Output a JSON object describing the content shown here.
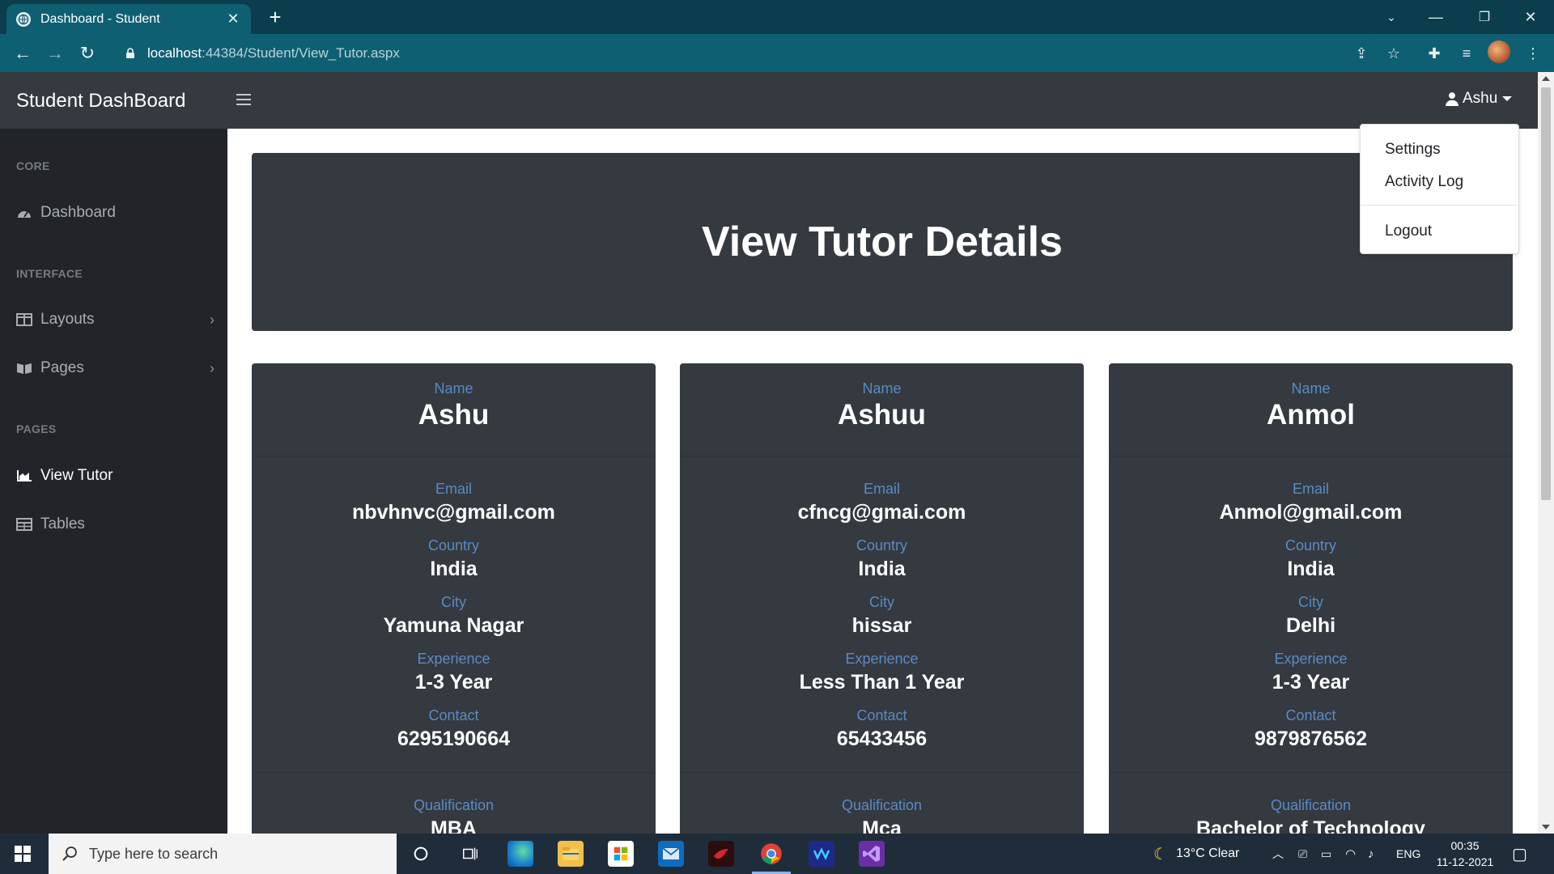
{
  "browser": {
    "tab_title": "Dashboard - Student",
    "tab_close": "✕",
    "new_tab": "+",
    "url_host": "localhost",
    "url_path": ":44384/Student/View_Tutor.aspx"
  },
  "topnav": {
    "brand": "Student DashBoard",
    "user_name": "Ashu"
  },
  "user_dropdown": {
    "items": [
      "Settings",
      "Activity Log",
      "Logout"
    ]
  },
  "sidebar": {
    "sections": [
      {
        "heading": "CORE"
      },
      {
        "heading": "INTERFACE"
      },
      {
        "heading": "PAGES"
      }
    ],
    "items": [
      {
        "label": "Dashboard",
        "icon": "tachometer-icon"
      },
      {
        "label": "Layouts",
        "icon": "columns-icon"
      },
      {
        "label": "Pages",
        "icon": "book-open-icon"
      },
      {
        "label": "View Tutor",
        "icon": "area-chart-icon"
      },
      {
        "label": "Tables",
        "icon": "table-icon"
      }
    ]
  },
  "main": {
    "hero_title": "View Tutor Details",
    "labels": {
      "name": "Name",
      "email": "Email",
      "country": "Country",
      "city": "City",
      "experience": "Experience",
      "contact": "Contact",
      "qualification": "Qualification"
    },
    "tutors": [
      {
        "name": "Ashu",
        "email": "nbvhnvc@gmail.com",
        "country": "India",
        "city": "Yamuna Nagar",
        "experience": "1-3 Year",
        "contact": "6295190664",
        "qualification": "MBA"
      },
      {
        "name": "Ashuu",
        "email": "cfncg@gmai.com",
        "country": "India",
        "city": "hissar",
        "experience": "Less Than 1 Year",
        "contact": "65433456",
        "qualification": "Mca"
      },
      {
        "name": "Anmol",
        "email": "Anmol@gmail.com",
        "country": "India",
        "city": "Delhi",
        "experience": "1-3 Year",
        "contact": "9879876562",
        "qualification": "Bachelor of Technology"
      }
    ]
  },
  "taskbar": {
    "search_placeholder": "Type here to search",
    "weather": "13°C  Clear",
    "language": "ENG",
    "time": "00:35",
    "date": "11-12-2021"
  },
  "colors": {
    "topbar_bg": "#343a40",
    "sidebar_bg": "#212529",
    "label_blue": "#5b8ac4",
    "browser_tab_bg": "#0b3d4c"
  }
}
